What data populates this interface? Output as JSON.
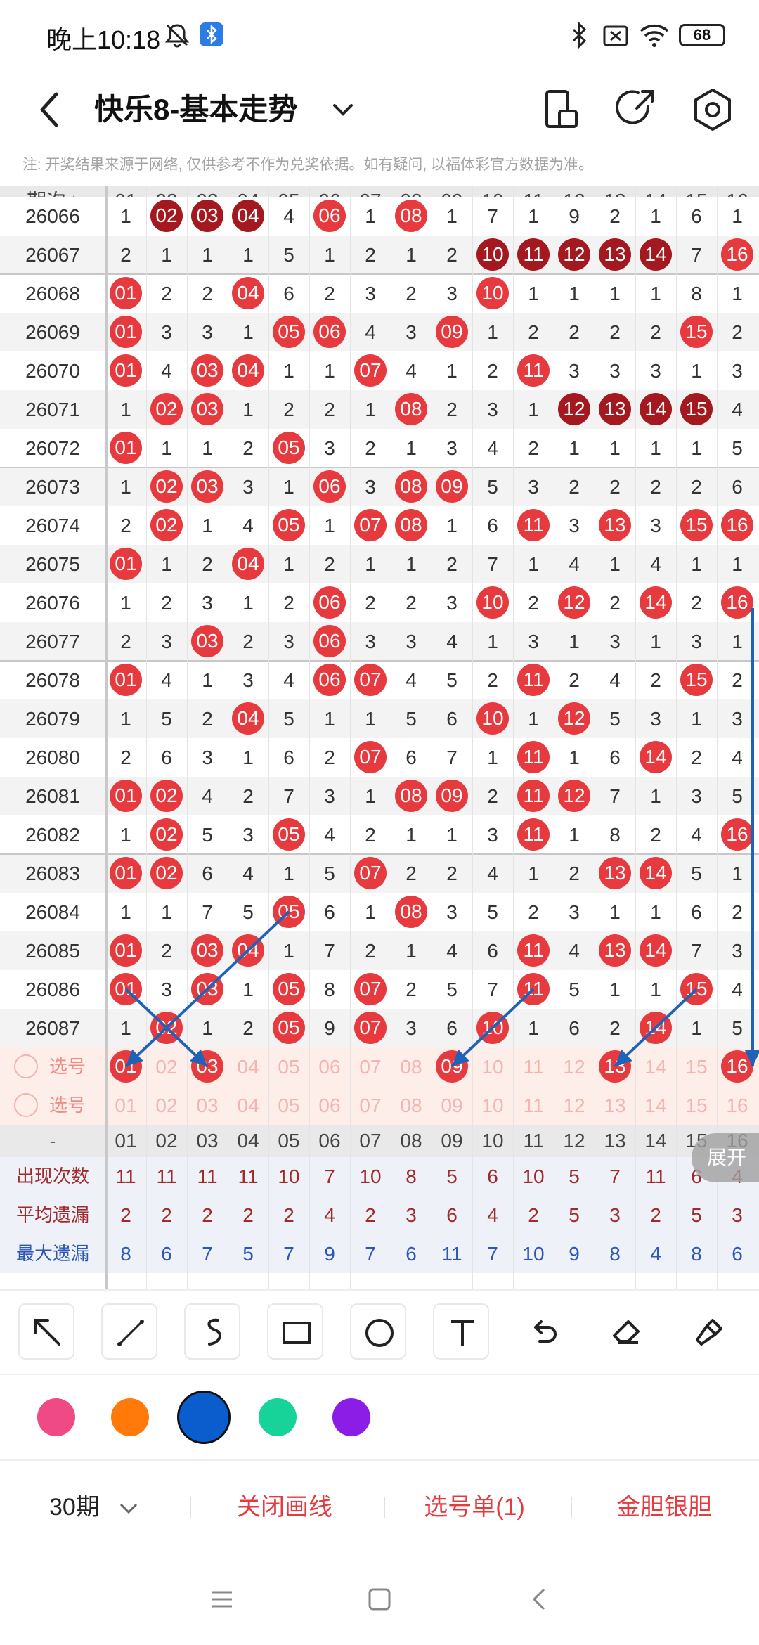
{
  "status": {
    "time": "晚上10:18",
    "battery": "68"
  },
  "titlebar": {
    "title": "快乐8-基本走势"
  },
  "note": "注: 开奖结果来源于网络, 仅供参考不作为兑奖依据。如有疑问, 以福体彩官方数据为准。",
  "grid": {
    "period_header": "期次",
    "columns": [
      "01",
      "02",
      "03",
      "04",
      "05",
      "06",
      "07",
      "08",
      "09",
      "10",
      "11",
      "12",
      "13",
      "14",
      "15",
      "16"
    ],
    "rows": [
      {
        "period": "26066",
        "cells": [
          "1",
          "02",
          "03",
          "04",
          "4",
          "06",
          "1",
          "08",
          "1",
          "7",
          "1",
          "9",
          "2",
          "1",
          "6",
          "1"
        ]
      },
      {
        "period": "26067",
        "cells": [
          "2",
          "1",
          "1",
          "1",
          "5",
          "1",
          "2",
          "1",
          "2",
          "10",
          "11",
          "12",
          "13",
          "14",
          "7",
          "16"
        ]
      },
      {
        "period": "26068",
        "cells": [
          "01",
          "2",
          "2",
          "04",
          "6",
          "2",
          "3",
          "2",
          "3",
          "10",
          "1",
          "1",
          "1",
          "1",
          "8",
          "1"
        ]
      },
      {
        "period": "26069",
        "cells": [
          "01",
          "3",
          "3",
          "1",
          "05",
          "06",
          "4",
          "3",
          "09",
          "1",
          "2",
          "2",
          "2",
          "2",
          "15",
          "2"
        ]
      },
      {
        "period": "26070",
        "cells": [
          "01",
          "4",
          "03",
          "04",
          "1",
          "1",
          "07",
          "4",
          "1",
          "2",
          "11",
          "3",
          "3",
          "3",
          "1",
          "3"
        ]
      },
      {
        "period": "26071",
        "cells": [
          "1",
          "02",
          "03",
          "1",
          "2",
          "2",
          "1",
          "08",
          "2",
          "3",
          "1",
          "12",
          "13",
          "14",
          "15",
          "4"
        ]
      },
      {
        "period": "26072",
        "cells": [
          "01",
          "1",
          "1",
          "2",
          "05",
          "3",
          "2",
          "1",
          "3",
          "4",
          "2",
          "1",
          "1",
          "1",
          "1",
          "5"
        ]
      },
      {
        "period": "26073",
        "cells": [
          "1",
          "02",
          "03",
          "3",
          "1",
          "06",
          "3",
          "08",
          "09",
          "5",
          "3",
          "2",
          "2",
          "2",
          "2",
          "6"
        ]
      },
      {
        "period": "26074",
        "cells": [
          "2",
          "02",
          "1",
          "4",
          "05",
          "1",
          "07",
          "08",
          "1",
          "6",
          "11",
          "3",
          "13",
          "3",
          "15",
          "16"
        ]
      },
      {
        "period": "26075",
        "cells": [
          "01",
          "1",
          "2",
          "04",
          "1",
          "2",
          "1",
          "1",
          "2",
          "7",
          "1",
          "4",
          "1",
          "4",
          "1",
          "1"
        ]
      },
      {
        "period": "26076",
        "cells": [
          "1",
          "2",
          "3",
          "1",
          "2",
          "06",
          "2",
          "2",
          "3",
          "10",
          "2",
          "12",
          "2",
          "14",
          "2",
          "16"
        ]
      },
      {
        "period": "26077",
        "cells": [
          "2",
          "3",
          "03",
          "2",
          "3",
          "06",
          "3",
          "3",
          "4",
          "1",
          "3",
          "1",
          "3",
          "1",
          "3",
          "1"
        ]
      },
      {
        "period": "26078",
        "cells": [
          "01",
          "4",
          "1",
          "3",
          "4",
          "06",
          "07",
          "4",
          "5",
          "2",
          "11",
          "2",
          "4",
          "2",
          "15",
          "2"
        ]
      },
      {
        "period": "26079",
        "cells": [
          "1",
          "5",
          "2",
          "04",
          "5",
          "1",
          "1",
          "5",
          "6",
          "10",
          "1",
          "12",
          "5",
          "3",
          "1",
          "3"
        ]
      },
      {
        "period": "26080",
        "cells": [
          "2",
          "6",
          "3",
          "1",
          "6",
          "2",
          "07",
          "6",
          "7",
          "1",
          "11",
          "1",
          "6",
          "14",
          "2",
          "4"
        ]
      },
      {
        "period": "26081",
        "cells": [
          "01",
          "02",
          "4",
          "2",
          "7",
          "3",
          "1",
          "08",
          "09",
          "2",
          "11",
          "12",
          "7",
          "1",
          "3",
          "5"
        ]
      },
      {
        "period": "26082",
        "cells": [
          "1",
          "02",
          "5",
          "3",
          "05",
          "4",
          "2",
          "1",
          "1",
          "3",
          "11",
          "1",
          "8",
          "2",
          "4",
          "16"
        ]
      },
      {
        "period": "26083",
        "cells": [
          "01",
          "02",
          "6",
          "4",
          "1",
          "5",
          "07",
          "2",
          "2",
          "4",
          "1",
          "2",
          "13",
          "14",
          "5",
          "1"
        ]
      },
      {
        "period": "26084",
        "cells": [
          "1",
          "1",
          "7",
          "5",
          "05",
          "6",
          "1",
          "08",
          "3",
          "5",
          "2",
          "3",
          "1",
          "1",
          "6",
          "2"
        ]
      },
      {
        "period": "26085",
        "cells": [
          "01",
          "2",
          "03",
          "04",
          "1",
          "7",
          "2",
          "1",
          "4",
          "6",
          "11",
          "4",
          "13",
          "14",
          "7",
          "3"
        ]
      },
      {
        "period": "26086",
        "cells": [
          "01",
          "3",
          "03",
          "1",
          "05",
          "8",
          "07",
          "2",
          "5",
          "7",
          "11",
          "5",
          "1",
          "1",
          "15",
          "4"
        ]
      },
      {
        "period": "26087",
        "cells": [
          "1",
          "02",
          "1",
          "2",
          "05",
          "9",
          "07",
          "3",
          "6",
          "10",
          "1",
          "6",
          "2",
          "14",
          "1",
          "5"
        ]
      }
    ],
    "pick_rows": [
      {
        "label": "选号",
        "selected": [
          "01",
          "03",
          "09",
          "13",
          "16"
        ]
      },
      {
        "label": "选号",
        "selected": []
      }
    ],
    "stats_header_label": "-",
    "stats": [
      {
        "label": "出现次数",
        "color": "#a12a2a",
        "values": [
          "11",
          "11",
          "11",
          "11",
          "10",
          "7",
          "10",
          "8",
          "5",
          "6",
          "10",
          "5",
          "7",
          "11",
          "6",
          "4"
        ]
      },
      {
        "label": "平均遗漏",
        "color": "#a12a2a",
        "values": [
          "2",
          "2",
          "2",
          "2",
          "2",
          "4",
          "2",
          "3",
          "6",
          "4",
          "2",
          "5",
          "3",
          "2",
          "5",
          "3"
        ]
      },
      {
        "label": "最大遗漏",
        "color": "#2c57b8",
        "values": [
          "8",
          "6",
          "7",
          "5",
          "7",
          "9",
          "7",
          "6",
          "11",
          "7",
          "10",
          "9",
          "8",
          "4",
          "8",
          "6"
        ]
      }
    ],
    "expand_label": "展开"
  },
  "toolbar": {
    "tools": [
      "arrow-icon",
      "line-icon",
      "freehand-icon",
      "rectangle-icon",
      "circle-icon",
      "text-icon",
      "undo-icon",
      "eraser-icon",
      "clear-icon"
    ]
  },
  "colors": {
    "options": [
      "#ef4a86",
      "#ff7a0a",
      "#0b5ccc",
      "#17d39a",
      "#8c1de6"
    ],
    "selected_index": 2
  },
  "bottom": {
    "period_select": "30期",
    "close_lines": "关闭画线",
    "pick_list": "选号单(1)",
    "gold_silver": "金胆银胆"
  },
  "theme": {
    "red": "#e63a3f",
    "dark_red": "#a3191f",
    "blue_arrow": "#1f63b8"
  }
}
